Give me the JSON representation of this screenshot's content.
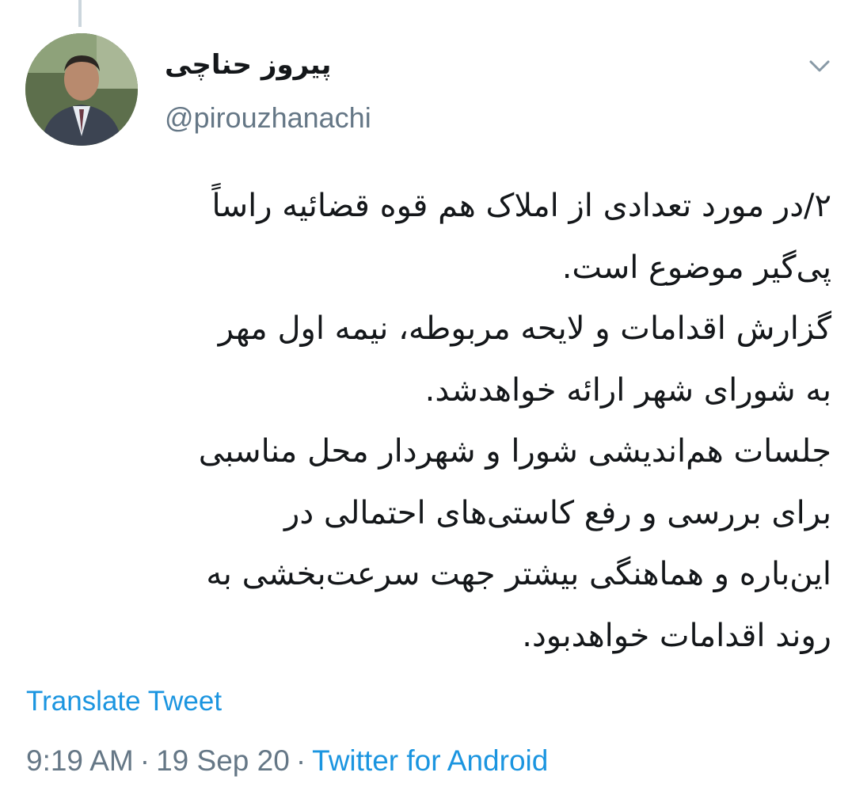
{
  "tweet": {
    "display_name": "پیروز حناچی",
    "handle": "@pirouzhanachi",
    "menu_icon": "chevron-down-icon",
    "body_lines": [
      "۲/در مورد تعدادی از املاک هم قوه قضائیه راساً",
      "پی‌گیر موضوع است.",
      "گزارش اقدامات و لایحه مربوطه، نیمه اول مهر",
      "به شورای شهر ارائه خواهدشد.",
      "جلسات هم‌اندیشی شورا و شهردار محل مناسبی",
      "برای بررسی و رفع کاستی‌های احتمالی در",
      "این‌باره و هماهنگی بیشتر جهت سرعت‌بخشی به",
      "روند اقدامات خواهدبود."
    ],
    "translate_label": "Translate Tweet",
    "time": "9:19 AM",
    "separator": "·",
    "date": "19 Sep 20",
    "source": "Twitter for Android"
  },
  "colors": {
    "link": "#1b95e0",
    "secondary_text": "#657786",
    "primary_text": "#14171a",
    "thread_line": "#ccd6dd"
  }
}
